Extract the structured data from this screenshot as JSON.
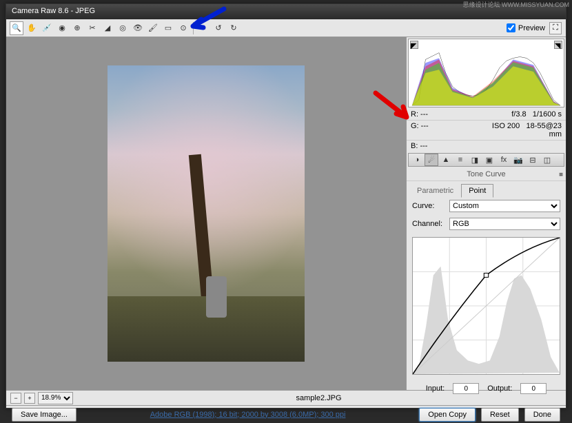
{
  "title": "Camera Raw 8.6  -  JPEG",
  "watermark": "思缘设计论坛  WWW.MISSYUAN.COM",
  "preview_label": "Preview",
  "exif": {
    "r": "R:   ---",
    "g": "G:   ---",
    "b": "B:   ---",
    "aperture": "f/3.8",
    "shutter": "1/1600 s",
    "iso": "ISO 200",
    "lens": "18-55@23 mm"
  },
  "panel": {
    "title": "Tone Curve",
    "tabs": {
      "parametric": "Parametric",
      "point": "Point"
    },
    "curve_label": "Curve:",
    "curve_value": "Custom",
    "channel_label": "Channel:",
    "channel_value": "RGB",
    "input_label": "Input:",
    "input_value": "0",
    "output_label": "Output:",
    "output_value": "0"
  },
  "status": {
    "zoom": "18.9%",
    "filename": "sample2.JPG"
  },
  "bottom": {
    "save": "Save Image...",
    "info": "Adobe RGB (1998); 16 bit; 2000 by 3008 (6.0MP); 300 ppi",
    "open": "Open Copy",
    "reset": "Reset",
    "done": "Done"
  },
  "chart_data": {
    "type": "line",
    "title": "Tone Curve (Point)",
    "xlabel": "Input",
    "ylabel": "Output",
    "xlim": [
      0,
      255
    ],
    "ylim": [
      0,
      255
    ],
    "series": [
      {
        "name": "Custom",
        "x": [
          0,
          32,
          64,
          96,
          128,
          160,
          192,
          224,
          255
        ],
        "values": [
          0,
          65,
          115,
          155,
          185,
          210,
          230,
          245,
          255
        ]
      }
    ],
    "histogram_background": {
      "x": [
        0,
        16,
        32,
        48,
        64,
        80,
        96,
        112,
        128,
        144,
        160,
        176,
        192,
        208,
        224,
        240,
        255
      ],
      "values": [
        5,
        30,
        120,
        200,
        80,
        40,
        25,
        20,
        30,
        90,
        180,
        160,
        100,
        60,
        30,
        10,
        2
      ]
    }
  }
}
